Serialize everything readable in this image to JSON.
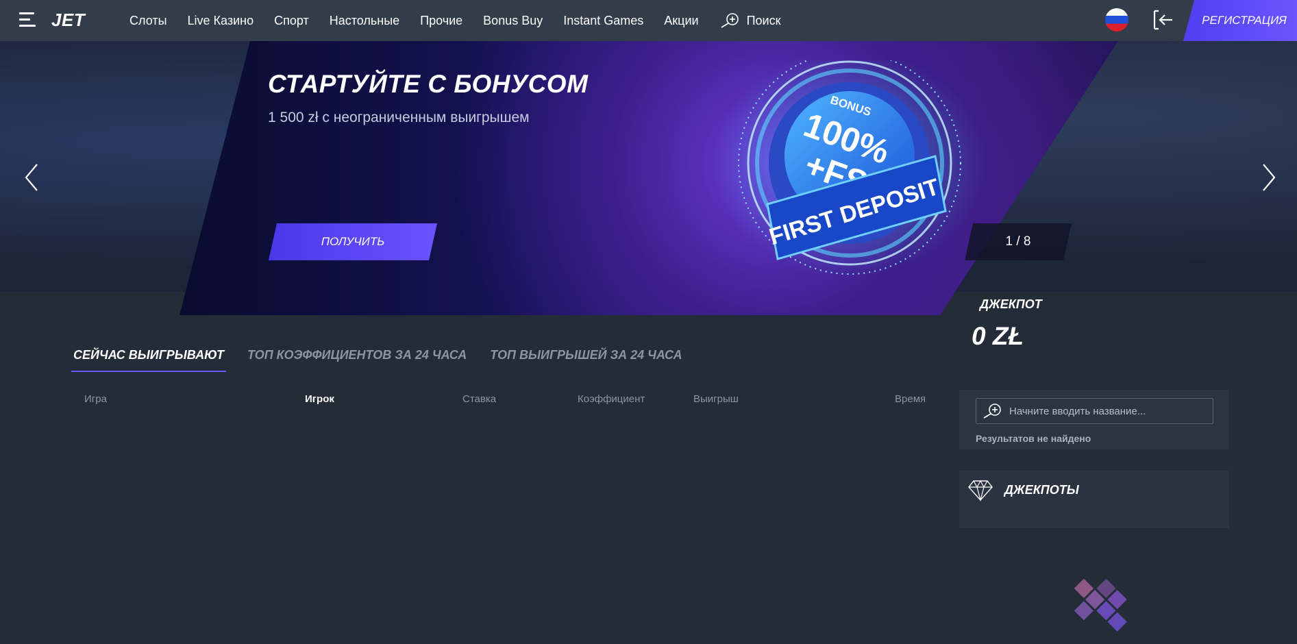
{
  "header": {
    "logo": "JET",
    "nav": [
      "Слоты",
      "Live Казино",
      "Спорт",
      "Настольные",
      "Прочие",
      "Bonus Buy",
      "Instant Games",
      "Акции"
    ],
    "search_label": "Поиск",
    "register_label": "РЕГИСТРАЦИЯ",
    "language": "ru"
  },
  "banner": {
    "title": "СТАРТУЙТЕ С БОНУСОМ",
    "subtitle": "1 500 zł с неограниченным выигрышем",
    "button_label": "ПОЛУЧИТЬ",
    "counter": "1 / 8",
    "badge": {
      "bonus": "BONUS",
      "line1": "100%",
      "line2": "+FS",
      "ribbon": "FIRST DEPOSIT"
    }
  },
  "jackpot": {
    "label": "ДЖЕКПОТ",
    "amount": "0 ZŁ"
  },
  "winners": {
    "tabs": [
      "СЕЙЧАС ВЫИГРЫВАЮТ",
      "ТОП КОЭФФИЦИЕНТОВ ЗА 24 ЧАСА",
      "ТОП ВЫИГРЫШЕЙ ЗА 24 ЧАСА"
    ],
    "active_tab": 0,
    "columns": [
      "Игра",
      "Игрок",
      "Ставка",
      "Коэффициент",
      "Выигрыш",
      "Время"
    ],
    "active_column": 1
  },
  "game_search": {
    "placeholder": "Начните вводить название...",
    "value": "",
    "no_results": "Результатов не найдено"
  },
  "jackpots_widget": {
    "title": "ДЖЕКПОТЫ"
  },
  "colors": {
    "accent": "#6b55ff",
    "header_bg": "#323d49",
    "page_bg": "#232c37"
  }
}
